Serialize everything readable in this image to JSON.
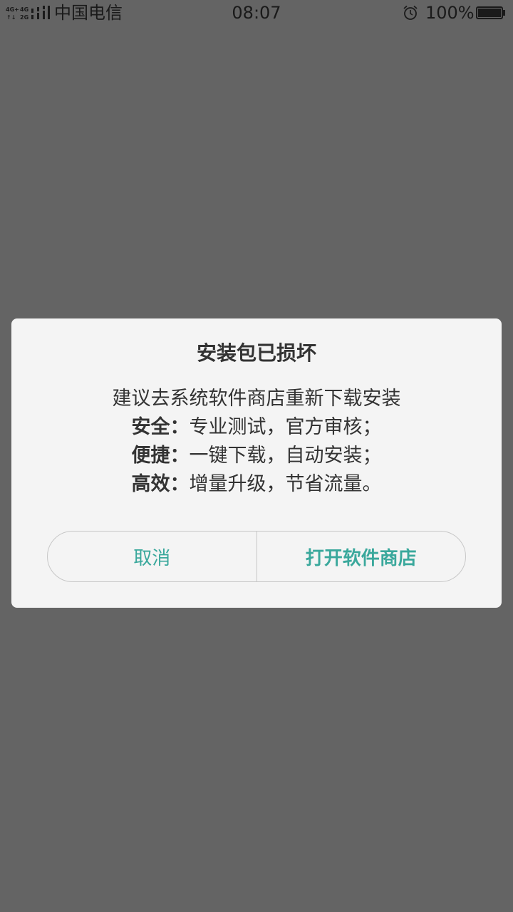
{
  "status_bar": {
    "network_icon": "signal-4g-2g-icon",
    "carrier": "中国电信",
    "time": "08:07",
    "alarm_icon": "alarm-clock-icon",
    "battery_percent": "100%",
    "battery_icon": "battery-full-icon",
    "battery_level": 1.0
  },
  "dialog": {
    "title": "安装包已损坏",
    "intro": "建议去系统软件商店重新下载安装",
    "features": [
      {
        "label": "安全：",
        "text": "专业测试，官方审核；"
      },
      {
        "label": "便捷：",
        "text": "一键下载，自动安装；"
      },
      {
        "label": "高效：",
        "text": "增量升级，节省流量。"
      }
    ],
    "buttons": {
      "cancel": "取消",
      "confirm": "打开软件商店"
    }
  },
  "colors": {
    "overlay": "#646464",
    "dialog_background": "#f4f4f4",
    "text": "#333333",
    "accent": "#3aa89c",
    "border": "#c7c7c7"
  }
}
